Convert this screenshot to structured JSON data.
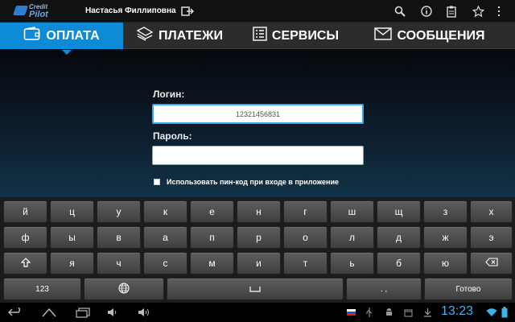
{
  "app": {
    "logo_line1": "Credit",
    "logo_line2": "Pilot",
    "user_name": "Настасья Филлиповна"
  },
  "topbar": {
    "icons": [
      "logout-icon",
      "search-icon",
      "info-icon",
      "clipboard-icon",
      "star-icon",
      "overflow-menu-icon"
    ]
  },
  "tabs": [
    {
      "label": "ОПЛАТА",
      "icon": "wallet-icon",
      "active": true
    },
    {
      "label": "ПЛАТЕЖИ",
      "icon": "payments-icon",
      "active": false
    },
    {
      "label": "СЕРВИСЫ",
      "icon": "services-list-icon",
      "active": false
    },
    {
      "label": "СООБЩЕНИЯ",
      "icon": "envelope-icon",
      "active": false
    }
  ],
  "login": {
    "login_label": "Логин:",
    "login_value": "12321456831",
    "password_label": "Пароль:",
    "password_value": "",
    "pin_checkbox_label": "Использовать пин-код при входе в приложение",
    "pin_checked": false
  },
  "keyboard": {
    "row1": [
      "й",
      "ц",
      "у",
      "к",
      "е",
      "н",
      "г",
      "ш",
      "щ",
      "з",
      "х"
    ],
    "row2": [
      "ф",
      "ы",
      "в",
      "а",
      "п",
      "р",
      "о",
      "л",
      "д",
      "ж",
      "э"
    ],
    "row3": [
      "я",
      "ч",
      "с",
      "м",
      "и",
      "т",
      "ь",
      "б",
      "ю"
    ],
    "numbers_key": "123",
    "punct_key": ". ,",
    "go_key": "Готово"
  },
  "statusbar": {
    "time": "13:23"
  },
  "colors": {
    "accent": "#0d8bd6",
    "clock": "#3fb3e8",
    "tabbar": "#2c2c2c"
  }
}
